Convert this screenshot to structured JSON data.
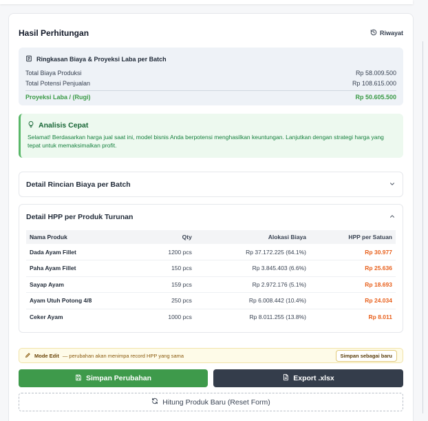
{
  "header": {
    "title": "Hasil Perhitungan",
    "history_label": "Riwayat"
  },
  "summary": {
    "title": "Ringkasan Biaya & Proyeksi Laba per Batch",
    "rows": [
      {
        "label": "Total Biaya Produksi",
        "value": "Rp 58.009.500"
      },
      {
        "label": "Total Potensi Penjualan",
        "value": "Rp 108.615.000"
      }
    ],
    "profit": {
      "label": "Proyeksi Laba / (Rugi)",
      "value": "Rp 50.605.500"
    }
  },
  "analysis": {
    "title": "Analisis Cepat",
    "text": "Selamat! Berdasarkan harga jual saat ini, model bisnis Anda berpotensi menghasilkan keuntungan. Lanjutkan dengan strategi harga yang tepat untuk memaksimalkan profit."
  },
  "accordion_cost": {
    "title": "Detail Rincian Biaya per Batch"
  },
  "accordion_hpp": {
    "title": "Detail HPP per Produk Turunan",
    "columns": [
      "Nama Produk",
      "Qty",
      "Alokasi Biaya",
      "HPP per Satuan"
    ],
    "rows": [
      {
        "name": "Dada Ayam Fillet",
        "qty": "1200 pcs",
        "alloc": "Rp 37.172.225 (64.1%)",
        "hpp": "Rp 30.977"
      },
      {
        "name": "Paha Ayam Fillet",
        "qty": "150 pcs",
        "alloc": "Rp 3.845.403 (6.6%)",
        "hpp": "Rp 25.636"
      },
      {
        "name": "Sayap Ayam",
        "qty": "159 pcs",
        "alloc": "Rp 2.972.176 (5.1%)",
        "hpp": "Rp 18.693"
      },
      {
        "name": "Ayam Utuh Potong 4/8",
        "qty": "250 pcs",
        "alloc": "Rp 6.008.442 (10.4%)",
        "hpp": "Rp 24.034"
      },
      {
        "name": "Ceker Ayam",
        "qty": "1000 pcs",
        "alloc": "Rp 8.011.255 (13.8%)",
        "hpp": "Rp 8.011"
      }
    ]
  },
  "mode_edit": {
    "label": "Mode Edit",
    "text": "— perubahan akan menimpa record HPP yang sama",
    "save_new_label": "Simpan sebagai baru"
  },
  "actions": {
    "save_label": "Simpan Perubahan",
    "export_label": "Export .xlsx",
    "reset_label": "Hitung Produk Baru (Reset Form)"
  },
  "colors": {
    "green": "#3e9a4b",
    "dark": "#343d4b",
    "orange": "#e8601c",
    "profit_green": "#3a9a46"
  }
}
